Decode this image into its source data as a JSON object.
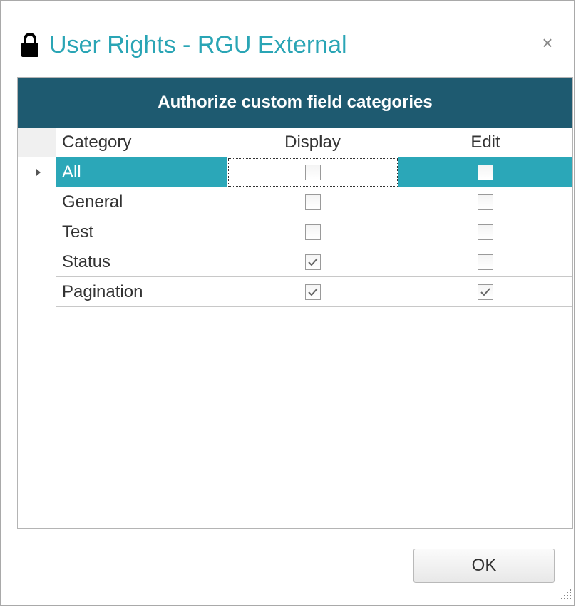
{
  "dialog": {
    "title": "User Rights - RGU External",
    "close_glyph": "×",
    "lock_icon": "lock-icon"
  },
  "panel": {
    "header": "Authorize custom field categories",
    "columns": {
      "category": "Category",
      "display": "Display",
      "edit": "Edit"
    },
    "rows": [
      {
        "category": "All",
        "display": false,
        "edit": false,
        "selected": true
      },
      {
        "category": "General",
        "display": false,
        "edit": false,
        "selected": false
      },
      {
        "category": "Test",
        "display": false,
        "edit": false,
        "selected": false
      },
      {
        "category": "Status",
        "display": true,
        "edit": false,
        "selected": false
      },
      {
        "category": "Pagination",
        "display": true,
        "edit": true,
        "selected": false
      }
    ]
  },
  "footer": {
    "ok_label": "OK"
  },
  "colors": {
    "title": "#2aa5b5",
    "header_bg": "#1e5a70",
    "selection": "#2ba7b8"
  }
}
